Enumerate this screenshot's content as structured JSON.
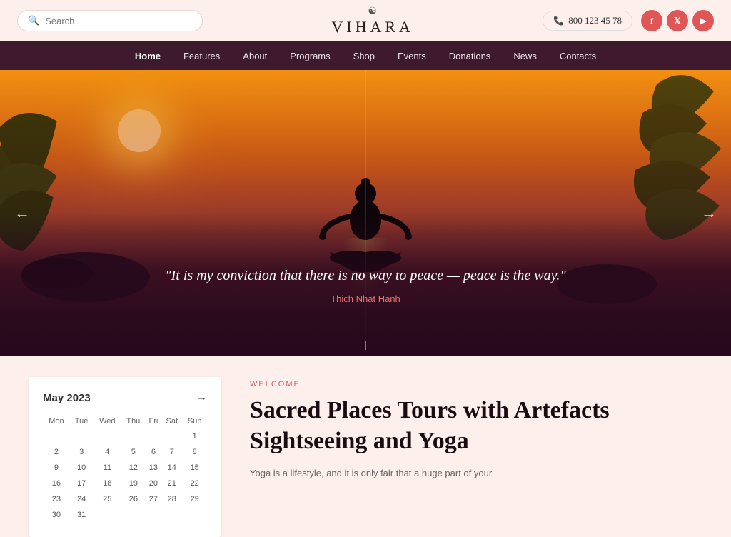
{
  "header": {
    "search_placeholder": "Search",
    "logo_text": "VIHARA",
    "logo_symbol": "☯",
    "phone": "800 123 45 78",
    "social": [
      {
        "name": "facebook",
        "label": "f"
      },
      {
        "name": "twitter",
        "label": "t"
      },
      {
        "name": "youtube",
        "label": "▶"
      }
    ]
  },
  "nav": {
    "items": [
      {
        "label": "Home",
        "active": true
      },
      {
        "label": "Features"
      },
      {
        "label": "About"
      },
      {
        "label": "Programs"
      },
      {
        "label": "Shop"
      },
      {
        "label": "Events"
      },
      {
        "label": "Donations"
      },
      {
        "label": "News"
      },
      {
        "label": "Contacts"
      }
    ]
  },
  "hero": {
    "quote": "\"It is my conviction that there is no way to peace — peace is the way.\"",
    "author": "Thich Nhat Hanh",
    "arrow_left": "←",
    "arrow_right": "→"
  },
  "calendar": {
    "month": "May 2023",
    "arrow": "→",
    "days_header": [
      "Mon",
      "Tue",
      "Wed",
      "Thu",
      "Fri",
      "Sat",
      "Sun"
    ],
    "weeks": [
      [
        "",
        "",
        "",
        "",
        "",
        "",
        "1"
      ],
      [
        "2",
        "3",
        "4",
        "5",
        "6",
        "7",
        "8"
      ],
      [
        "9",
        "10",
        "11",
        "12",
        "13",
        "14",
        "15"
      ],
      [
        "16",
        "17",
        "18",
        "19",
        "20",
        "21",
        "22"
      ],
      [
        "23",
        "24",
        "25",
        "26",
        "27",
        "28",
        "29"
      ],
      [
        "30",
        "31",
        "",
        "",
        "",
        "",
        ""
      ]
    ]
  },
  "welcome": {
    "label": "WELCOME",
    "title": "Sacred Places Tours with Artefacts Sightseeing and Yoga",
    "description": "Yoga is a lifestyle, and it is only fair that a huge part of your"
  }
}
